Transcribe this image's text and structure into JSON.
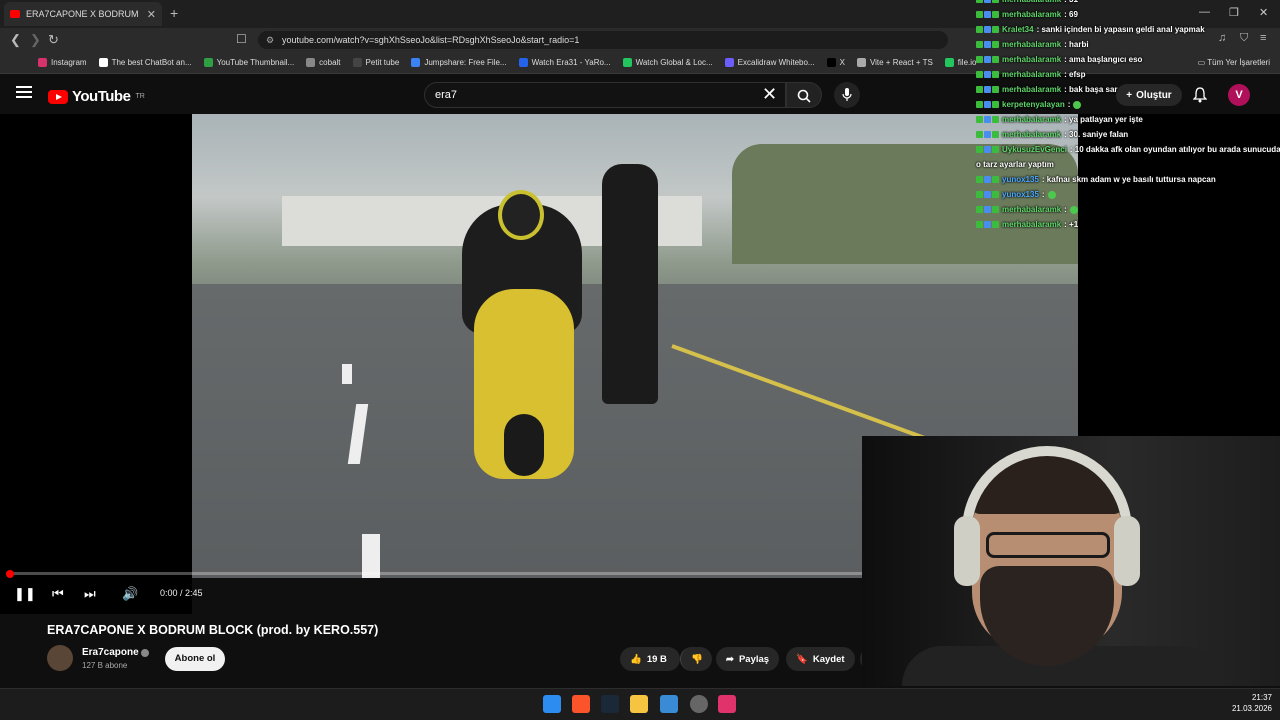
{
  "browser": {
    "tab_title": "ERA7CAPONE X BODRUM BLOCK",
    "url": "youtube.com/watch?v=sghXhSseoJo&list=RDsghXhSseoJo&start_radio=1",
    "bookmarks": [
      {
        "label": "Instagram",
        "color": "#d6336c"
      },
      {
        "label": "The best ChatBot an...",
        "color": "#ffffff"
      },
      {
        "label": "YouTube Thumbnail...",
        "color": "#2ea043"
      },
      {
        "label": "cobalt",
        "color": "#888888"
      },
      {
        "label": "Petit tube",
        "color": "#444444"
      },
      {
        "label": "Jumpshare: Free File...",
        "color": "#3b82f6"
      },
      {
        "label": "Watch Era31 - YaRo...",
        "color": "#2563eb"
      },
      {
        "label": "Watch Global & Loc...",
        "color": "#22c55e"
      },
      {
        "label": "Excalidraw Whitebo...",
        "color": "#6d5dfc"
      },
      {
        "label": "X",
        "color": "#000000"
      },
      {
        "label": "Vite + React + TS",
        "color": "#aaaaaa"
      },
      {
        "label": "file.io",
        "color": "#22c55e"
      }
    ],
    "all_bookmarks": "Tüm Yer İşaretleri"
  },
  "youtube": {
    "logo_word": "YouTube",
    "logo_region": "TR",
    "search_value": "era7",
    "create_label": "Oluştur",
    "avatar_letter": "V"
  },
  "player": {
    "time_current": "0:00",
    "time_total": "2:45",
    "progress_fraction": 0.002
  },
  "video": {
    "title": "ERA7CAPONE X BODRUM BLOCK (prod. by KERO.557)",
    "channel": "Era7capone",
    "subscribers": "127 B abone",
    "subscribe_label": "Abone ol",
    "likes": "19 B",
    "share_label": "Paylaş",
    "save_label": "Kaydet"
  },
  "chat": [
    {
      "user": "merhabalaramk",
      "msg": ": 31",
      "color": "green"
    },
    {
      "user": "merhabalaramk",
      "msg": ": 69",
      "color": "green"
    },
    {
      "user": "Kralet34",
      "msg": ": sanki içinden bi yapasın geldi anal yapmak",
      "color": "green"
    },
    {
      "user": "merhabalaramk",
      "msg": ": harbi",
      "color": "green"
    },
    {
      "user": "merhabalaramk",
      "msg": ": ama başlangıcı eso",
      "color": "green"
    },
    {
      "user": "merhabalaramk",
      "msg": ": efsp",
      "color": "green"
    },
    {
      "user": "merhabalaramk",
      "msg": ": bak başa sar",
      "color": "green"
    },
    {
      "user": "kerpetenyalayan",
      "msg": ":",
      "color": "green",
      "emote": true
    },
    {
      "user": "merhabalaramk",
      "msg": ": ya patlayan yer işte",
      "color": "green"
    },
    {
      "user": "merhabalaramk",
      "msg": ": 30. saniye falan",
      "color": "green"
    },
    {
      "user": "UykusuzEvGenci",
      "msg": ": 10 dakka afk olan oyundan atılıyor bu arada sunucuda",
      "color": "green"
    },
    {
      "user": "",
      "msg": "o tarz ayarlar yaptım",
      "color": "green"
    },
    {
      "user": "yunox135",
      "msg": ": kafnaı skm adam w ye basılı tuttursa napcan",
      "color": "blue"
    },
    {
      "user": "yunox135",
      "msg": ":",
      "color": "blue",
      "emote": true
    },
    {
      "user": "merhabalaramk",
      "msg": ":",
      "color": "green",
      "emote": true
    },
    {
      "user": "merhabalaramk",
      "msg": ": +1",
      "color": "green"
    }
  ],
  "taskbar": {
    "time": "21:37",
    "date": "21.03.2026"
  }
}
